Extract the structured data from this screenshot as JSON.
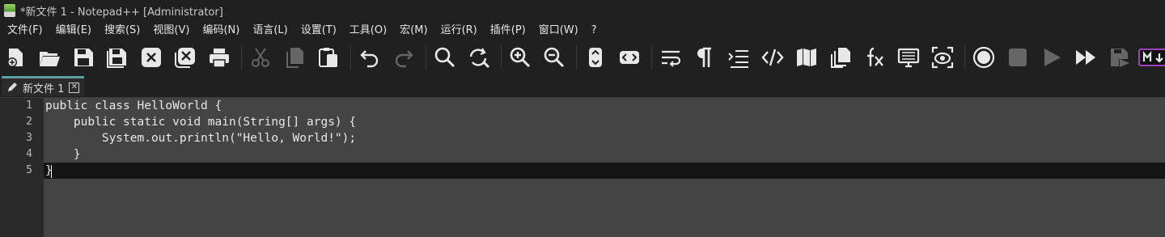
{
  "window": {
    "title": "*新文件 1 - Notepad++ [Administrator]"
  },
  "menu": [
    "文件(F)",
    "编辑(E)",
    "搜索(S)",
    "视图(V)",
    "编码(N)",
    "语言(L)",
    "设置(T)",
    "工具(O)",
    "宏(M)",
    "运行(R)",
    "插件(P)",
    "窗口(W)",
    "?"
  ],
  "toolbar": {
    "buttons": [
      {
        "icon": "new-file-icon"
      },
      {
        "icon": "open-folder-icon"
      },
      {
        "icon": "save-icon"
      },
      {
        "icon": "save-all-icon"
      },
      {
        "icon": "close-icon"
      },
      {
        "icon": "close-all-icon"
      },
      {
        "icon": "print-icon"
      },
      {
        "icon": "cut-icon"
      },
      {
        "icon": "copy-icon"
      },
      {
        "icon": "paste-icon"
      },
      {
        "icon": "undo-icon"
      },
      {
        "icon": "redo-icon"
      },
      {
        "icon": "find-icon"
      },
      {
        "icon": "replace-icon"
      },
      {
        "icon": "zoom-in-icon"
      },
      {
        "icon": "zoom-out-icon"
      },
      {
        "icon": "sync-vertical-icon"
      },
      {
        "icon": "sync-horizontal-icon"
      },
      {
        "icon": "word-wrap-icon"
      },
      {
        "icon": "show-all-characters-icon"
      },
      {
        "icon": "indent-guide-icon"
      },
      {
        "icon": "xml-tag-icon"
      },
      {
        "icon": "document-map-icon"
      },
      {
        "icon": "document-list-icon"
      },
      {
        "icon": "function-list-icon"
      },
      {
        "icon": "folder-as-workspace-icon"
      },
      {
        "icon": "monitoring-icon"
      },
      {
        "icon": "record-macro-icon"
      },
      {
        "icon": "stop-recording-icon"
      },
      {
        "icon": "play-macro-icon"
      },
      {
        "icon": "run-macro-multiple-icon"
      },
      {
        "icon": "save-macro-icon"
      },
      {
        "icon": "markdown-icon"
      }
    ]
  },
  "tabs": [
    {
      "label": "新文件 1"
    }
  ],
  "editor": {
    "line_numbers": [
      "1",
      "2",
      "3",
      "4",
      "5"
    ],
    "lines": [
      "public class HelloWorld {",
      "    public static void main(String[] args) {",
      "        System.out.println(\"Hello, World!\");",
      "    }",
      "}"
    ],
    "current_line": 5
  },
  "colors": {
    "accent": "#5aa0a0",
    "background": "#202020",
    "editor_bg": "#444444",
    "current_line": "#151515"
  }
}
